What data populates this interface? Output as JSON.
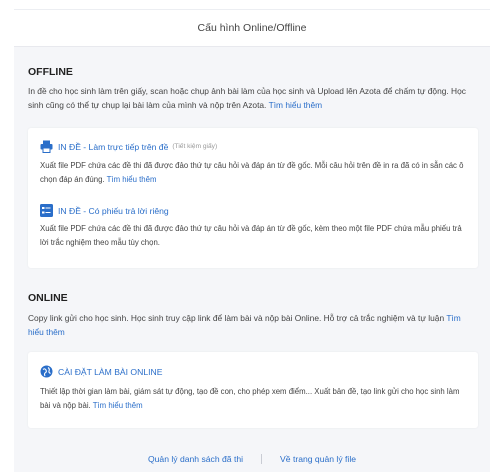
{
  "header": {
    "title": "Cấu hình Online/Offline"
  },
  "offline": {
    "heading": "OFFLINE",
    "desc": "In đề cho học sinh làm trên giấy, scan hoặc chụp ảnh bài làm của học sinh và Upload lên Azota để chấm tự động. Học sinh cũng có thể tự chụp lại bài làm của mình và nộp trên Azota.",
    "link": "Tìm hiểu thêm",
    "options": [
      {
        "icon": "printer-icon",
        "title": "IN ĐỀ - Làm trực tiếp trên đề",
        "note": "(Tiết kiệm giấy)",
        "desc": "Xuất file PDF chứa các đề thi đã được đảo thứ tự câu hỏi và đáp án từ đề gốc. Mỗi câu hỏi trên đề in ra đã có in sẵn các ô chọn đáp án đúng.",
        "link": "Tìm hiểu thêm"
      },
      {
        "icon": "answer-sheet-icon",
        "title": "IN ĐỀ - Có phiếu trả lời riêng",
        "desc": "Xuất file PDF chứa các đề thi đã được đảo thứ tự câu hỏi và đáp án từ đề gốc, kèm theo một file PDF chứa mẫu phiếu trả lời trắc nghiệm theo mẫu tùy chọn."
      }
    ]
  },
  "online": {
    "heading": "ONLINE",
    "desc": "Copy link gửi cho học sinh. Học sinh truy cập link để làm bài và nộp bài Online. Hỗ trợ cả trắc nghiệm và tự luận",
    "link": "Tìm hiểu thêm",
    "option": {
      "icon": "globe-icon",
      "title": "CÀI ĐẶT LÀM BÀI ONLINE",
      "desc": "Thiết lập thời gian làm bài, giám sát tự động, tạo đề con, cho phép xem điểm... Xuất bản đề, tạo link gửi cho học sinh làm bài và nộp bài.",
      "link": "Tìm hiểu thêm"
    }
  },
  "footer": {
    "manage_link": "Quản lý danh sách đã thi",
    "back_link": "Về trang quản lý file"
  },
  "colors": {
    "accent": "#2a6ec9",
    "background": "#f5f6f9"
  }
}
